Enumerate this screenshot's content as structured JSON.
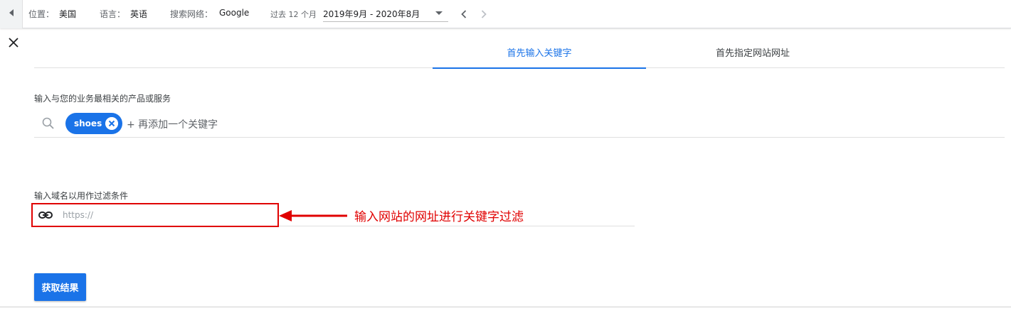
{
  "topbar": {
    "location_label": "位置：",
    "location_value": "美国",
    "language_label": "语言：",
    "language_value": "英语",
    "network_label": "搜索网络：",
    "network_value": "Google",
    "period_label": "过去 12 个月",
    "date_range": "2019年9月 - 2020年8月"
  },
  "tabs": [
    {
      "label": "首先输入关键字",
      "active": true
    },
    {
      "label": "首先指定网站网址",
      "active": false
    }
  ],
  "keywords": {
    "label": "输入与您的业务最相关的产品或服务",
    "chips": [
      "shoes"
    ],
    "add_placeholder": "+ 再添加一个关键字"
  },
  "domain_filter": {
    "label": "输入域名以用作过滤条件",
    "placeholder": "https://",
    "value": ""
  },
  "annotation": {
    "text": "输入网站的网址进行关键字过滤",
    "color": "#e00000"
  },
  "submit_label": "获取结果",
  "colors": {
    "accent": "#1a73e8",
    "annotation": "#e00000"
  },
  "icons": [
    "back-icon",
    "dropdown-icon",
    "chevron-left-icon",
    "chevron-right-icon",
    "close-icon",
    "search-icon",
    "chip-remove-icon",
    "link-icon"
  ]
}
